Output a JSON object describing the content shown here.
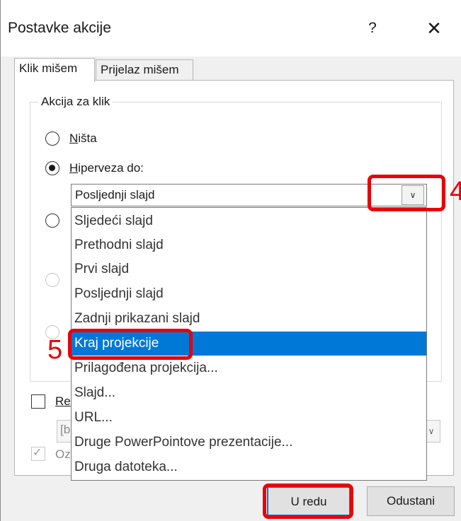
{
  "dialog": {
    "title": "Postavke akcije",
    "help_label": "?",
    "close_label": "✕"
  },
  "tabs": [
    {
      "label": "Klik mišem",
      "active": true
    },
    {
      "label": "Prijelaz mišem",
      "active": false
    }
  ],
  "group": {
    "title": "Akcija za klik"
  },
  "options": {
    "none": {
      "accel": "N",
      "rest": "išta",
      "checked": false
    },
    "hyperlink": {
      "accel": "H",
      "rest": "iperveza do:",
      "checked": true
    }
  },
  "hyperlink_combo": {
    "value": "Posljednji slajd",
    "arrow": "∨"
  },
  "dropdown_items": [
    "Sljedeći slajd",
    "Prethodni slajd",
    "Prvi slajd",
    "Posljednji slajd",
    "Zadnji prikazani slajd",
    "Kraj projekcije",
    "Prilagođena projekcija...",
    "Slajd...",
    "URL...",
    "Druge PowerPointove prezentacije...",
    "Druga datoteka..."
  ],
  "dropdown_selected_index": 5,
  "partial": {
    "play_sound": "Re",
    "sound_value": "[b",
    "highlight": "Oz",
    "checkmark": "✓"
  },
  "buttons": {
    "ok": "U redu",
    "cancel": "Odustani"
  },
  "annotations": {
    "four": "4",
    "five": "5"
  },
  "colors": {
    "selection": "#0078d7",
    "annotation": "#e8000b"
  }
}
